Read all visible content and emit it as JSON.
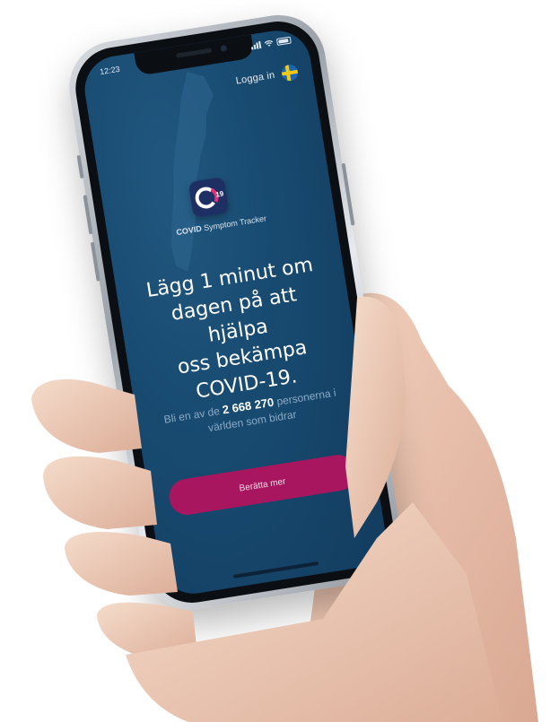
{
  "status": {
    "time": "12:23"
  },
  "header": {
    "login_label": "Logga in",
    "flag_icon": "sweden-flag-icon"
  },
  "brand": {
    "logo_text": "19",
    "name_bold": "COVID",
    "name_rest": " Symptom Tracker"
  },
  "headline": {
    "lines": [
      "Lägg 1 minut om",
      "dagen på att hjälpa",
      "oss bekämpa",
      "COVID-19."
    ]
  },
  "counter": {
    "prefix": "Bli en av de ",
    "number": "2 668 270",
    "suffix": " personerna i världen som bidrar"
  },
  "cta": {
    "label": "Berätta mer"
  },
  "colors": {
    "screen": "#184a70",
    "cta": "#a8165f",
    "logo_bg": "#1d2f63",
    "accent_pink": "#e0307a"
  }
}
